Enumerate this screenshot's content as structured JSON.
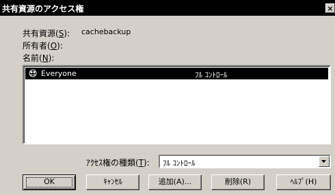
{
  "window": {
    "title": "共有資源のアクセス権",
    "close_label": "×"
  },
  "info": {
    "share_label": "共有資源",
    "share_mnemonic": "S",
    "share_value": "cachebackup",
    "owner_label": "所有者",
    "owner_mnemonic": "O",
    "names_label": "名前",
    "names_mnemonic": "N"
  },
  "list": {
    "items": [
      {
        "icon": "everyone-group-icon",
        "name": "Everyone",
        "permission": "ﾌﾙ ｺﾝﾄﾛｰﾙ",
        "selected": true
      }
    ]
  },
  "access_type": {
    "label": "ｱｸｾｽ権の種類",
    "mnemonic": "T",
    "value": "ﾌﾙ ｺﾝﾄﾛｰﾙ"
  },
  "buttons": {
    "ok": "OK",
    "cancel": "ｷｬﾝｾﾙ",
    "add": "追加(A)...",
    "remove": "削除(R)",
    "help": "ﾍﾙﾌﾟ(H)"
  },
  "colors": {
    "titlebar": "#000000",
    "face": "#d4d0c8",
    "selection": "#000000"
  }
}
